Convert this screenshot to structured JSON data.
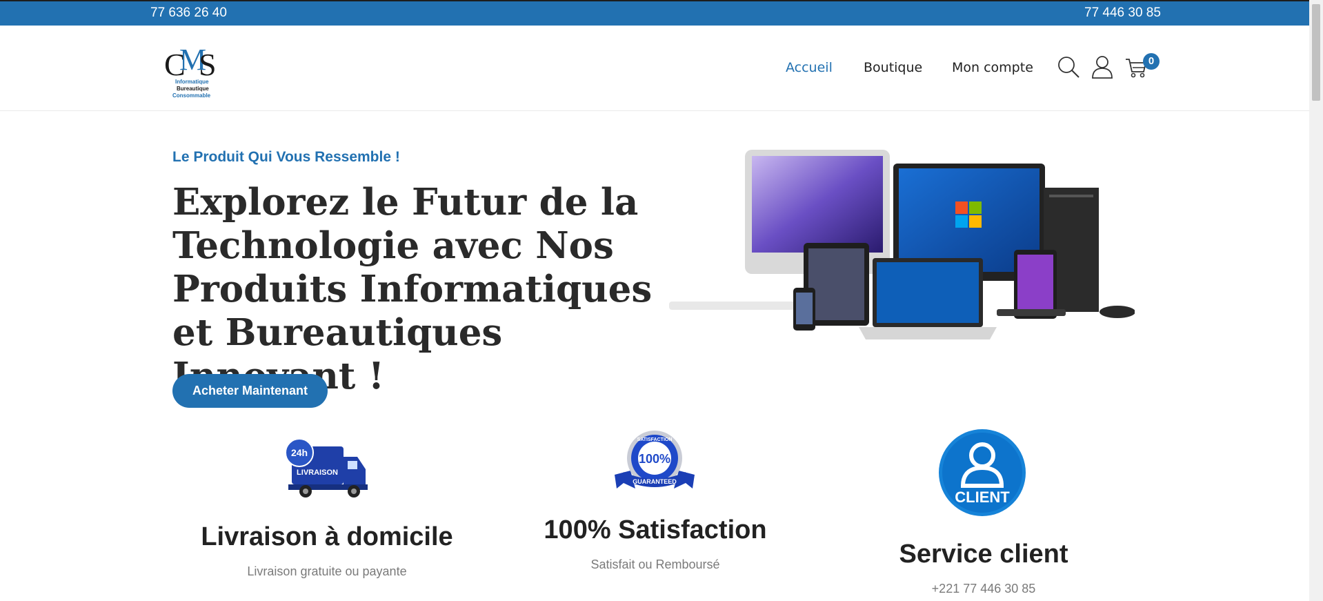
{
  "topbar": {
    "phone_left": "77 636 26 40",
    "phone_right": "77 446 30 85",
    "color": "#2271b1"
  },
  "logo": {
    "mark": "CMS",
    "line1": "Informatique",
    "line2": "Bureautique",
    "line3": "Consommable"
  },
  "nav": {
    "home": "Accueil",
    "shop": "Boutique",
    "account": "Mon compte"
  },
  "header_icons": [
    "search-icon",
    "user-icon",
    "cart-icon"
  ],
  "cart": {
    "count": "0"
  },
  "hero": {
    "tagline": "Le Produit Qui Vous Ressemble !",
    "headline": "Explorez le Futur de la Technologie avec Nos Produits Informatiques et Bureautiques Innovant !",
    "cta": "Acheter Maintenant"
  },
  "features": [
    {
      "icon": "delivery-truck-icon",
      "badge": "24h",
      "icon_text": "LIVRAISON",
      "title": "Livraison à domicile",
      "subtitle": "Livraison gratuite ou payante"
    },
    {
      "icon": "satisfaction-badge-icon",
      "badge": "100%",
      "icon_text": "SATISFACTION",
      "icon_text2": "GUARANTEED",
      "title": "100% Satisfaction",
      "subtitle": "Satisfait ou Remboursé"
    },
    {
      "icon": "client-icon",
      "icon_text": "CLIENT",
      "title": "Service client",
      "subtitle": "+221 77 446 30 85"
    }
  ],
  "colors": {
    "accent": "#2271b1",
    "text": "#222222",
    "muted": "#7a7a7a"
  }
}
